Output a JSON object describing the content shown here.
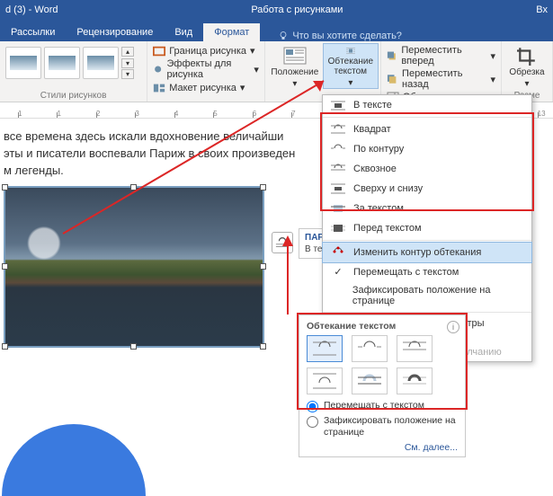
{
  "titlebar": {
    "doc": "d (3) - Word",
    "context": "Работа с рисунками",
    "right": "Вх"
  },
  "tabs": {
    "items": [
      "Рассылки",
      "Рецензирование",
      "Вид",
      "Формат"
    ],
    "tell_placeholder": "Что вы хотите сделать?"
  },
  "ribbon": {
    "styles_label": "Стили рисунков",
    "border": "Граница рисунка",
    "effects": "Эффекты для рисунка",
    "layout": "Макет рисунка",
    "position": "Положение",
    "wrap": "Обтекание текстом",
    "forward": "Переместить вперед",
    "backward": "Переместить назад",
    "selection": "Область выделения",
    "crop": "Обрезка",
    "size_label": "Разме"
  },
  "dropdown": {
    "items": [
      "В тексте",
      "Квадрат",
      "По контуру",
      "Сквозное",
      "Сверху и снизу",
      "За текстом",
      "Перед текстом"
    ],
    "edit_wrap": "Изменить контур обтекания",
    "move_with_text": "Перемещать с текстом",
    "fix_on_page": "Зафиксировать положение на странице",
    "more_options": "Дополнительные параметры разметки...",
    "default_layout": "Сделать макетом по умолчанию"
  },
  "document": {
    "p1": "все времена здесь искали вдохновение величайши",
    "p2": "эты и писатели воспевали Париж в своих произведен",
    "p3": "м легенды."
  },
  "flyout": {
    "title": "ПАРА",
    "sub": "В те"
  },
  "pane": {
    "title": "Обтекание текстом",
    "radio1": "Перемещать с текстом",
    "radio2": "Зафиксировать положение на странице",
    "more": "См. далее..."
  }
}
